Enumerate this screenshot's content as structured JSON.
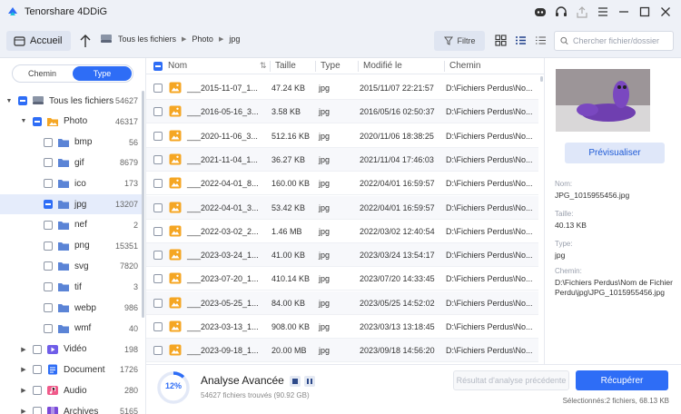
{
  "app": {
    "title": "Tenorshare 4DDiG"
  },
  "toolbar": {
    "home_label": "Accueil",
    "breadcrumb": [
      "Tous les fichiers",
      "Photo",
      "jpg"
    ],
    "filter_label": "Filtre",
    "search_placeholder": "Chercher fichier/dossier"
  },
  "sidebar": {
    "tabs": [
      "Chemin",
      "Type"
    ],
    "active_tab": "Type",
    "tree": [
      {
        "label": "Tous les fichiers",
        "count": "54627"
      },
      {
        "label": "Photo",
        "count": "46317"
      },
      {
        "label": "bmp",
        "count": "56"
      },
      {
        "label": "gif",
        "count": "8679"
      },
      {
        "label": "ico",
        "count": "173"
      },
      {
        "label": "jpg",
        "count": "13207"
      },
      {
        "label": "nef",
        "count": "2"
      },
      {
        "label": "png",
        "count": "15351"
      },
      {
        "label": "svg",
        "count": "7820"
      },
      {
        "label": "tif",
        "count": "3"
      },
      {
        "label": "webp",
        "count": "986"
      },
      {
        "label": "wmf",
        "count": "40"
      },
      {
        "label": "Vidéo",
        "count": "198"
      },
      {
        "label": "Document",
        "count": "1726"
      },
      {
        "label": "Audio",
        "count": "280"
      },
      {
        "label": "Archives",
        "count": "5165"
      }
    ]
  },
  "list": {
    "columns": {
      "name": "Nom",
      "size": "Taille",
      "type": "Type",
      "modified": "Modifié le",
      "path": "Chemin"
    },
    "rows": [
      {
        "name": "___2015-11-07_1...",
        "size": "47.24 KB",
        "type": "jpg",
        "modified": "2015/11/07 22:21:57",
        "path": "D:\\Fichiers Perdus\\No..."
      },
      {
        "name": "___2016-05-16_3...",
        "size": "3.58 KB",
        "type": "jpg",
        "modified": "2016/05/16 02:50:37",
        "path": "D:\\Fichiers Perdus\\No..."
      },
      {
        "name": "___2020-11-06_3...",
        "size": "512.16 KB",
        "type": "jpg",
        "modified": "2020/11/06 18:38:25",
        "path": "D:\\Fichiers Perdus\\No..."
      },
      {
        "name": "___2021-11-04_1...",
        "size": "36.27 KB",
        "type": "jpg",
        "modified": "2021/11/04 17:46:03",
        "path": "D:\\Fichiers Perdus\\No..."
      },
      {
        "name": "___2022-04-01_8...",
        "size": "160.00 KB",
        "type": "jpg",
        "modified": "2022/04/01 16:59:57",
        "path": "D:\\Fichiers Perdus\\No..."
      },
      {
        "name": "___2022-04-01_3...",
        "size": "53.42 KB",
        "type": "jpg",
        "modified": "2022/04/01 16:59:57",
        "path": "D:\\Fichiers Perdus\\No..."
      },
      {
        "name": "___2022-03-02_2...",
        "size": "1.46 MB",
        "type": "jpg",
        "modified": "2022/03/02 12:40:54",
        "path": "D:\\Fichiers Perdus\\No..."
      },
      {
        "name": "___2023-03-24_1...",
        "size": "41.00 KB",
        "type": "jpg",
        "modified": "2023/03/24 13:54:17",
        "path": "D:\\Fichiers Perdus\\No..."
      },
      {
        "name": "___2023-07-20_1...",
        "size": "410.14 KB",
        "type": "jpg",
        "modified": "2023/07/20 14:33:45",
        "path": "D:\\Fichiers Perdus\\No..."
      },
      {
        "name": "___2023-05-25_1...",
        "size": "84.00 KB",
        "type": "jpg",
        "modified": "2023/05/25 14:52:02",
        "path": "D:\\Fichiers Perdus\\No..."
      },
      {
        "name": "___2023-03-13_1...",
        "size": "908.00 KB",
        "type": "jpg",
        "modified": "2023/03/13 13:18:45",
        "path": "D:\\Fichiers Perdus\\No..."
      },
      {
        "name": "___2023-09-18_1...",
        "size": "20.00 MB",
        "type": "jpg",
        "modified": "2023/09/18 14:56:20",
        "path": "D:\\Fichiers Perdus\\No..."
      }
    ]
  },
  "details": {
    "preview_button": "Prévisualiser",
    "name_label": "Nom:",
    "name_value": "JPG_1015955456.jpg",
    "size_label": "Taille:",
    "size_value": "40.13 KB",
    "type_label": "Type:",
    "type_value": "jpg",
    "path_label": "Chemin:",
    "path_value": "D:\\Fichiers Perdus\\Nom de Fichier Perdu\\jpg\\JPG_1015955456.jpg"
  },
  "bottom": {
    "progress": "12%",
    "progress_fraction": 0.12,
    "title": "Analyse Avancée",
    "subtitle": "54627 fichiers trouvés (90.92 GB)",
    "prev_result": "Résultat d'analyse précédente",
    "recover": "Récupérer",
    "selection": "Sélectionnés:2 fichiers, 68.13 KB"
  },
  "colors": {
    "accent": "#2e6df6",
    "folder": "#5b84d6",
    "photo_folder": "#f5a623"
  }
}
